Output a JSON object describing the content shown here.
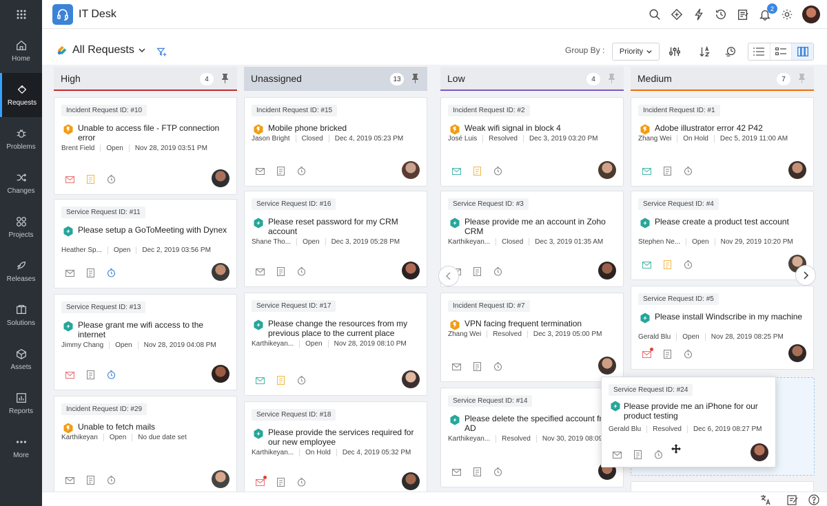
{
  "app": {
    "title": "IT Desk",
    "notification_count": "2"
  },
  "sidebar": {
    "items": [
      {
        "label": "Home"
      },
      {
        "label": "Requests"
      },
      {
        "label": "Problems"
      },
      {
        "label": "Changes"
      },
      {
        "label": "Projects"
      },
      {
        "label": "Releases"
      },
      {
        "label": "Solutions"
      },
      {
        "label": "Assets"
      },
      {
        "label": "Reports"
      },
      {
        "label": "More"
      }
    ]
  },
  "toolbar": {
    "view_title": "All Requests",
    "group_by_label": "Group By :",
    "group_by_value": "Priority"
  },
  "columns": [
    {
      "title": "High",
      "count": "4",
      "accent": "#c62828",
      "cards": [
        {
          "tag": "Incident Request ID: #10",
          "title": "Unable to access file - FTP connection error",
          "requester": "Brent Field",
          "status": "Open",
          "date": "Nov 28, 2019 03:51 PM"
        },
        {
          "tag": "Service Request ID: #11",
          "title": "Please setup a GoToMeeting with Dynex",
          "requester": "Heather Sp...",
          "status": "Open",
          "date": "Dec 2, 2019 03:56 PM"
        },
        {
          "tag": "Service Request ID: #13",
          "title": "Please grant me wifi access to the internet",
          "requester": "Jimmy Chang",
          "status": "Open",
          "date": "Nov 28, 2019 04:08 PM"
        },
        {
          "tag": "Incident Request ID: #29",
          "title": "Unable to fetch mails",
          "requester": "Karthikeyan",
          "status": "Open",
          "date": "No due date set"
        }
      ]
    },
    {
      "title": "Unassigned",
      "count": "13",
      "accent": "#cfd6e0",
      "cards": [
        {
          "tag": "Incident Request ID: #15",
          "title": "Mobile phone bricked",
          "requester": "Jason Bright",
          "status": "Closed",
          "date": "Dec 4, 2019 05:23 PM"
        },
        {
          "tag": "Service Request ID: #16",
          "title": "Please reset password for my CRM account",
          "requester": "Shane Tho...",
          "status": "Open",
          "date": "Dec 3, 2019 05:28 PM"
        },
        {
          "tag": "Service Request ID: #17",
          "title": "Please change the resources from my previous place to the current place",
          "requester": "Karthikeyan...",
          "status": "Open",
          "date": "Nov 28, 2019 08:10 PM"
        },
        {
          "tag": "Service Request ID: #18",
          "title": "Please provide the services required for our new employee",
          "requester": "Karthikeyan...",
          "status": "On Hold",
          "date": "Dec 4, 2019 05:32 PM"
        }
      ]
    },
    {
      "title": "Low",
      "count": "4",
      "accent": "#7e57c2",
      "cards": [
        {
          "tag": "Incident Request ID: #2",
          "title": "Weak wifi signal in block 4",
          "requester": "José Luis",
          "status": "Resolved",
          "date": "Dec 3, 2019 03:20 PM"
        },
        {
          "tag": "Service Request ID: #3",
          "title": "Please provide me an account in Zoho CRM",
          "requester": "Karthikeyan...",
          "status": "Closed",
          "date": "Dec 3, 2019 01:35 AM"
        },
        {
          "tag": "Incident Request ID: #7",
          "title": "VPN facing frequent termination",
          "requester": "Zhang Wei",
          "status": "Resolved",
          "date": "Dec 3, 2019 05:00 PM"
        },
        {
          "tag": "Service Request ID: #14",
          "title": "Please delete the specified account from AD",
          "requester": "Karthikeyan...",
          "status": "Resolved",
          "date": "Nov 30, 2019 08:09"
        }
      ]
    },
    {
      "title": "Medium",
      "count": "7",
      "accent": "#ef6c00",
      "cards": [
        {
          "tag": "Incident Request ID: #1",
          "title": "Adobe illustrator error 42 P42",
          "requester": "Zhang Wei",
          "status": "On Hold",
          "date": "Dec 5, 2019 11:00 AM"
        },
        {
          "tag": "Service Request ID: #4",
          "title": "Please create a product test account",
          "requester": "Stephen Ne...",
          "status": "Open",
          "date": "Nov 29, 2019 10:20 PM"
        },
        {
          "tag": "Service Request ID: #5",
          "title": "Please install Windscribe in my machine",
          "requester": "Gerald Blu",
          "status": "Open",
          "date": "Nov 28, 2019 08:25 PM"
        }
      ]
    }
  ],
  "drag_card": {
    "tag": "Service Request ID: #24",
    "title": "Please provide me an iPhone for our product testing",
    "requester": "Gerald Blu",
    "status": "Resolved",
    "date": "Dec 6, 2019 08:27 PM"
  },
  "colors": {
    "sidebar_bg": "#2b2f36",
    "accent_blue": "#3c83d8",
    "incident_icon": "#f39c12",
    "service_icon": "#26a69a"
  }
}
